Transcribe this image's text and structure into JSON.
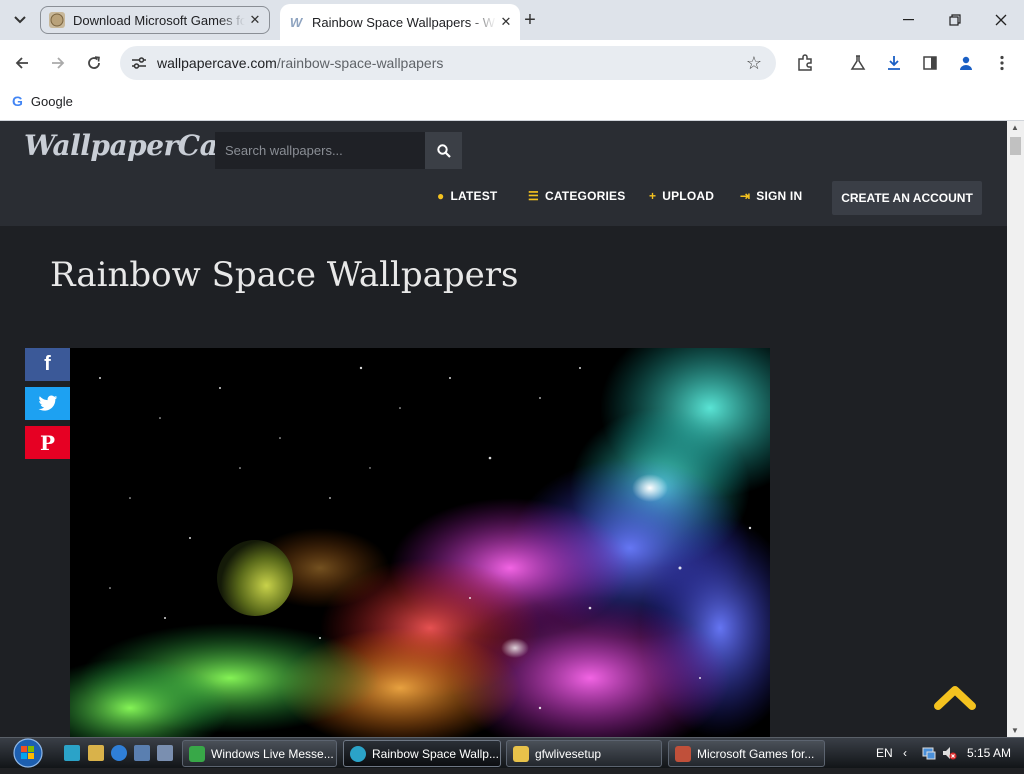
{
  "browser": {
    "tabs": [
      {
        "title": "Download Microsoft Games fo",
        "active": false
      },
      {
        "title": "Rainbow Space Wallpapers - W",
        "active": true
      }
    ],
    "url_domain": "wallpapercave.com",
    "url_path": "/rainbow-space-wallpapers",
    "bookmarks": [
      {
        "label": "Google"
      }
    ]
  },
  "site": {
    "logo": "WallpaperCave",
    "search_placeholder": "Search wallpapers...",
    "nav": [
      {
        "label": "LATEST",
        "icon": "clock-icon"
      },
      {
        "label": "CATEGORIES",
        "icon": "list-icon"
      },
      {
        "label": "UPLOAD",
        "icon": "plus-icon"
      },
      {
        "label": "SIGN IN",
        "icon": "sign-in-icon"
      }
    ],
    "create_account": "CREATE AN ACCOUNT",
    "page_title": "Rainbow Space Wallpapers",
    "share": [
      {
        "network": "facebook",
        "glyph": "f",
        "color": "#3b5998"
      },
      {
        "network": "twitter",
        "glyph": "t",
        "color": "#1da1f2"
      },
      {
        "network": "pinterest",
        "glyph": "P",
        "color": "#e60023"
      }
    ],
    "accent_color": "#f4c21f"
  },
  "taskbar": {
    "tasks": [
      {
        "label": "Windows Live Messe...",
        "active": false
      },
      {
        "label": "Rainbow Space Wallp...",
        "active": true
      },
      {
        "label": "gfwlivesetup",
        "active": false
      },
      {
        "label": "Microsoft Games for...",
        "active": false
      }
    ],
    "language": "EN",
    "time": "5:15 AM"
  }
}
